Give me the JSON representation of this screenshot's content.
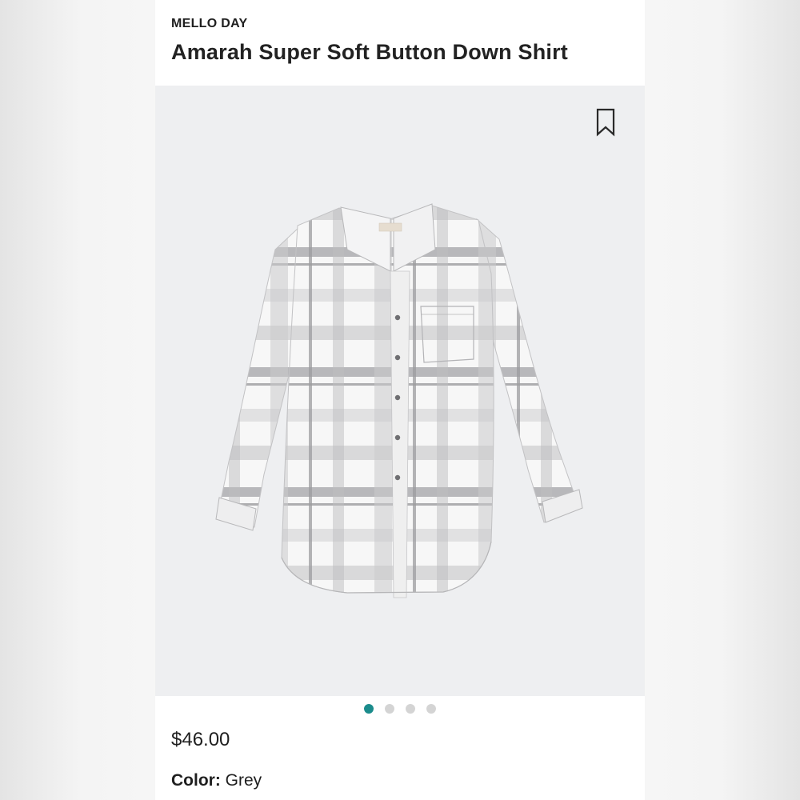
{
  "product": {
    "brand": "MELLO DAY",
    "title": "Amarah Super Soft Button Down Shirt",
    "price": "$46.00",
    "color_label": "Color:",
    "color_value": "Grey"
  },
  "gallery": {
    "image_subject": "grey plaid long-sleeve button down shirt",
    "bookmark_icon": "bookmark-outline-icon",
    "image_count": 4,
    "active_index": 0
  },
  "colors": {
    "active_dot": "#1b8c8c",
    "inactive_dot": "#d4d4d4",
    "image_background": "#eeeff1",
    "plaid_dark": "#9c9c9f",
    "plaid_light": "#c9c9cb"
  }
}
